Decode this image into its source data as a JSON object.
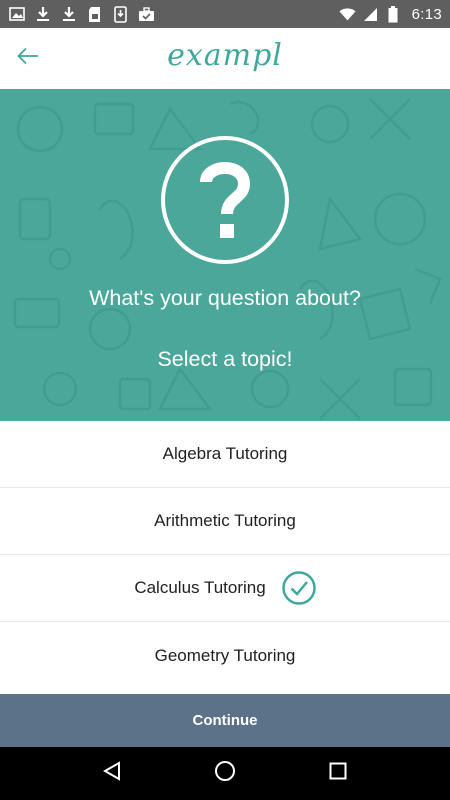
{
  "status_bar": {
    "time": "6:13",
    "left_icons": [
      "image-icon",
      "download-icon",
      "download-icon",
      "sim-card-icon",
      "phone-download-icon",
      "briefcase-check-icon"
    ],
    "right_icons": [
      "wifi-icon",
      "signal-icon",
      "battery-icon"
    ]
  },
  "app_bar": {
    "logo_text": "exampl",
    "back_icon": "arrow-left-icon"
  },
  "hero": {
    "icon": "question-circle-icon",
    "title": "What's your question about?",
    "subtitle": "Select a topic!"
  },
  "topics": {
    "items": [
      {
        "label": "Algebra Tutoring",
        "selected": false
      },
      {
        "label": "Arithmetic Tutoring",
        "selected": false
      },
      {
        "label": "Calculus Tutoring",
        "selected": true
      },
      {
        "label": "Geometry Tutoring",
        "selected": false
      }
    ]
  },
  "continue_label": "Continue",
  "colors": {
    "teal": "#4aa79a",
    "teal_dark": "#3ea99b",
    "continue_bg": "#5b7288",
    "status_bar": "#5f5f5f"
  },
  "nav_bar": [
    "back-triangle-icon",
    "home-circle-icon",
    "recents-square-icon"
  ]
}
